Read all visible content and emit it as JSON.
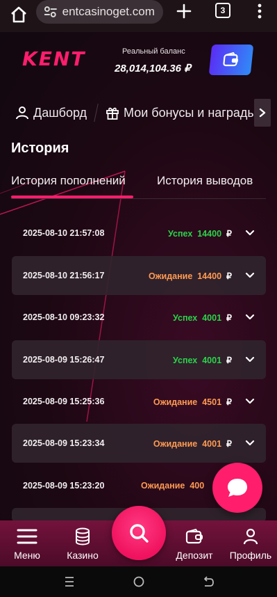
{
  "browser": {
    "url": "entcasinoget.com",
    "tab_count": "3"
  },
  "header": {
    "logo_text": "KENT",
    "balance_label": "Реальный баланс",
    "balance_value": "28,014,104.36 ₽"
  },
  "nav": {
    "items": [
      {
        "label": "Дашборд",
        "icon": "user-icon"
      },
      {
        "label": "Мои бонусы и награды",
        "icon": "gift-icon"
      }
    ]
  },
  "page": {
    "title": "История"
  },
  "tabs": [
    {
      "label": "История пополнений",
      "active": true
    },
    {
      "label": "История выводов",
      "active": false
    }
  ],
  "transactions": [
    {
      "datetime": "2025-08-10 21:57:08",
      "status": "Успех",
      "amount": "14400",
      "currency": "₽",
      "state": "ok"
    },
    {
      "datetime": "2025-08-10 21:56:17",
      "status": "Ожидание",
      "amount": "14400",
      "currency": "₽",
      "state": "wait"
    },
    {
      "datetime": "2025-08-10 09:23:32",
      "status": "Успех",
      "amount": "4001",
      "currency": "₽",
      "state": "ok"
    },
    {
      "datetime": "2025-08-09 15:26:47",
      "status": "Успех",
      "amount": "4001",
      "currency": "₽",
      "state": "ok"
    },
    {
      "datetime": "2025-08-09 15:25:36",
      "status": "Ожидание",
      "amount": "4501",
      "currency": "₽",
      "state": "wait"
    },
    {
      "datetime": "2025-08-09 15:23:34",
      "status": "Ожидание",
      "amount": "4001",
      "currency": "₽",
      "state": "wait"
    },
    {
      "datetime": "2025-08-09 15:23:20",
      "status": "Ожидание",
      "amount": "400",
      "currency": "",
      "state": "wait"
    }
  ],
  "bottom_nav": {
    "menu": "Меню",
    "casino": "Казино",
    "deposit": "Депозит",
    "profile": "Профиль"
  },
  "colors": {
    "accent": "#ff1d6c",
    "success": "#2ad34a",
    "pending": "#ff9a52"
  }
}
